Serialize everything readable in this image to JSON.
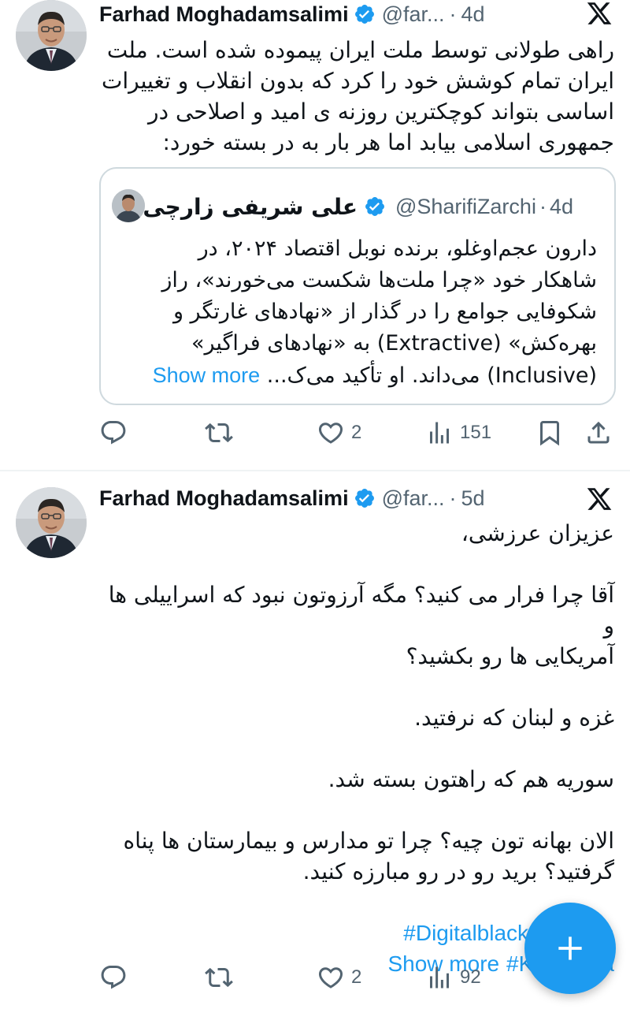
{
  "tweets": [
    {
      "author_name": "Farhad Moghadamsalimi",
      "handle": "@far...",
      "separator": "·",
      "time": "4d",
      "text_lines": [
        "راهی طولانی توسط ملت ایران پیموده شده است. ملت",
        "ایران تمام کوشش خود را کرد که بدون انقلاب و تغییرات",
        "اساسی بتواند کوچکترین روزنه ی امید و اصلاحی در",
        "جمهوری اسلامی بیابد اما هر بار به در بسته خورد:"
      ],
      "quote": {
        "author_name": "علی شریفی زارچی",
        "handle": "@SharifiZarchi",
        "separator": "·",
        "time": "4d",
        "text_lines": [
          "دارون عجم‌اوغلو، برنده نوبل اقتصاد ۲۰۲۴، در",
          "شاهکار خود «چرا ملت‌ها شکست می‌خورند»، راز",
          "شکوفایی جوامع را در گذار از «نهادهای غارتگر و",
          "بهره‌کش» (Extractive) به «نهادهای فراگیر»",
          "(Inclusive) می‌داند. او تأکید می‌ک..."
        ],
        "show_more": "Show more"
      },
      "actions": {
        "reply": "",
        "retweet": "",
        "likes": "2",
        "views": "151"
      }
    },
    {
      "author_name": "Farhad Moghadamsalimi",
      "handle": "@far...",
      "separator": "·",
      "time": "5d",
      "paragraphs": [
        [
          "عزیزان عرزشی،"
        ],
        [
          "آقا چرا فرار می کنید؟ مگه آرزوتون نبود که اسراییلی ها و",
          "آمریکایی ها رو بکشید؟"
        ],
        [
          "غزه و لبنان که نرفتید."
        ],
        [
          "سوریه هم که راهتون بسته شد."
        ],
        [
          "الان بهانه تون چیه؟ چرا تو مدارس و بیمارستان ها پناه",
          "گرفتید؟ برید رو در رو مبارزه کنید."
        ]
      ],
      "hashtag1": "#DigitalblackoutinIran",
      "show_more": "Show more",
      "hashtag2": "#KingReza",
      "actions": {
        "reply": "",
        "retweet": "",
        "likes": "2",
        "views": "92"
      }
    }
  ],
  "colors": {
    "accent": "#1d9bf0",
    "text": "#0f1419",
    "secondary": "#536471",
    "border": "#cfd9de"
  }
}
